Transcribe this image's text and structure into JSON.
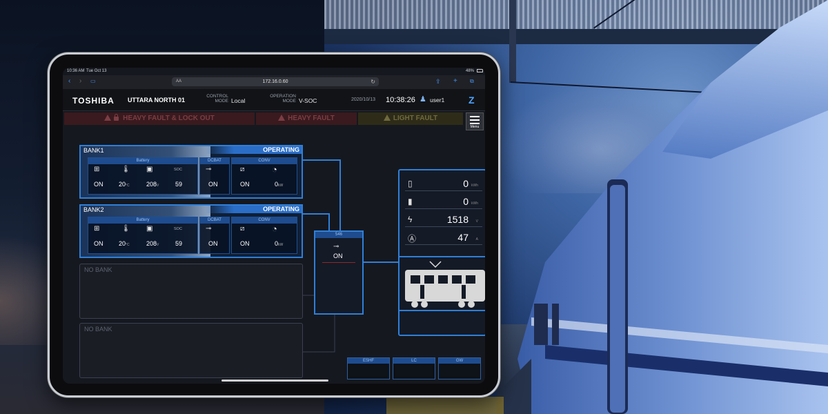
{
  "ios_status": {
    "time": "10:36 AM",
    "date": "Tue Oct 13",
    "battery": "48%"
  },
  "browser": {
    "url": "172.16.0.60",
    "reader_label": "AA"
  },
  "header": {
    "brand": "TOSHIBA",
    "station": "UTTARA NORTH 01",
    "control_mode_label_1": "CONTROL",
    "control_mode_label_2": "MODE",
    "control_mode": "Local",
    "operation_mode_label_1": "OPERATION",
    "operation_mode_label_2": "MODE",
    "operation_mode": "V-SOC",
    "date": "2020/10/13",
    "time": "10:38:26",
    "user": "user1"
  },
  "alarms": {
    "heavy_lockout": "HEAVY FAULT & LOCK OUT",
    "heavy": "HEAVY FAULT",
    "light": "LIGHT FAULT",
    "menu_label": "Menu"
  },
  "banks": [
    {
      "name": "BANK1",
      "status": "OPERATING",
      "battery_header": "Battery",
      "dcbat_header": "DCBAT",
      "conv_header": "CONV",
      "soc_label": "SOC",
      "battery_state": "ON",
      "temp": "20",
      "temp_unit": "°C",
      "voltage": "208",
      "voltage_unit": "V",
      "soc": "59",
      "dcbat_state": "ON",
      "conv_state": "ON",
      "conv_power": "0",
      "conv_unit": "kW"
    },
    {
      "name": "BANK2",
      "status": "OPERATING",
      "battery_header": "Battery",
      "dcbat_header": "DCBAT",
      "conv_header": "CONV",
      "soc_label": "SOC",
      "battery_state": "ON",
      "temp": "20",
      "temp_unit": "°C",
      "voltage": "208",
      "voltage_unit": "V",
      "soc": "59",
      "dcbat_state": "ON",
      "conv_state": "ON",
      "conv_power": "0",
      "conv_unit": "kW"
    }
  ],
  "empty_banks": [
    "NO BANK",
    "NO BANK"
  ],
  "switch_546": {
    "header": "546",
    "state": "ON"
  },
  "readings": [
    {
      "icon": "battery-charge-icon",
      "value": "0",
      "unit": "kWh"
    },
    {
      "icon": "battery-discharge-icon",
      "value": "0",
      "unit": "kWh"
    },
    {
      "icon": "lightning-icon",
      "value": "1518",
      "unit": "V"
    },
    {
      "icon": "ampere-icon",
      "value": "47",
      "unit": "A"
    }
  ],
  "bottom_boxes": [
    "ESHF",
    "LC",
    "GW"
  ],
  "colors": {
    "accent": "#2f7fd8",
    "panel": "#141a26",
    "fault": "#3a1a1e"
  }
}
